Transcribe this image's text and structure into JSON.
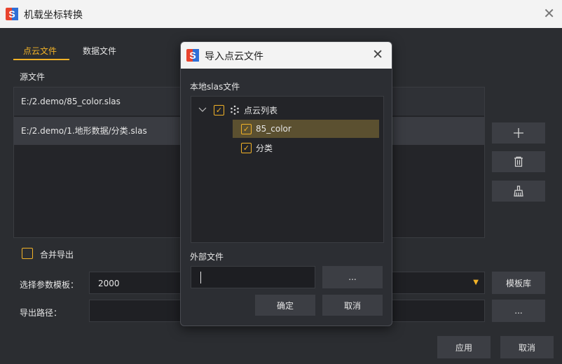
{
  "window": {
    "title": "机载坐标转换",
    "icon": "app-logo-icon",
    "close_icon": "close-icon"
  },
  "tabs": [
    {
      "label": "点云文件",
      "active": true
    },
    {
      "label": "数据文件",
      "active": false
    }
  ],
  "source": {
    "label": "源文件",
    "files": [
      "E:/2.demo/85_color.slas",
      "E:/2.demo/1.地形数据/分类.slas"
    ]
  },
  "side_buttons": [
    {
      "icon": "plus-icon",
      "glyph": "+"
    },
    {
      "icon": "trash-icon"
    },
    {
      "icon": "broom-icon"
    }
  ],
  "merge": {
    "label": "合并导出",
    "checked": false
  },
  "template": {
    "label": "选择参数模板：",
    "value": "2000",
    "library_label": "模板库"
  },
  "export_path": {
    "label": "导出路径：",
    "value": "",
    "browse_label": "..."
  },
  "footer": {
    "apply_label": "应用",
    "cancel_label": "取消"
  },
  "dialog": {
    "title": "导入点云文件",
    "local_label": "本地slas文件",
    "tree": {
      "root_label": "点云列表",
      "children": [
        "85_color",
        "分类"
      ],
      "selected_child": "85_color"
    },
    "external_label": "外部文件",
    "external_value": "",
    "browse_label": "...",
    "ok_label": "确定",
    "cancel_label": "取消"
  },
  "colors": {
    "accent": "#f2b227",
    "background": "#2b2d31",
    "selected_row": "#5b5030"
  }
}
